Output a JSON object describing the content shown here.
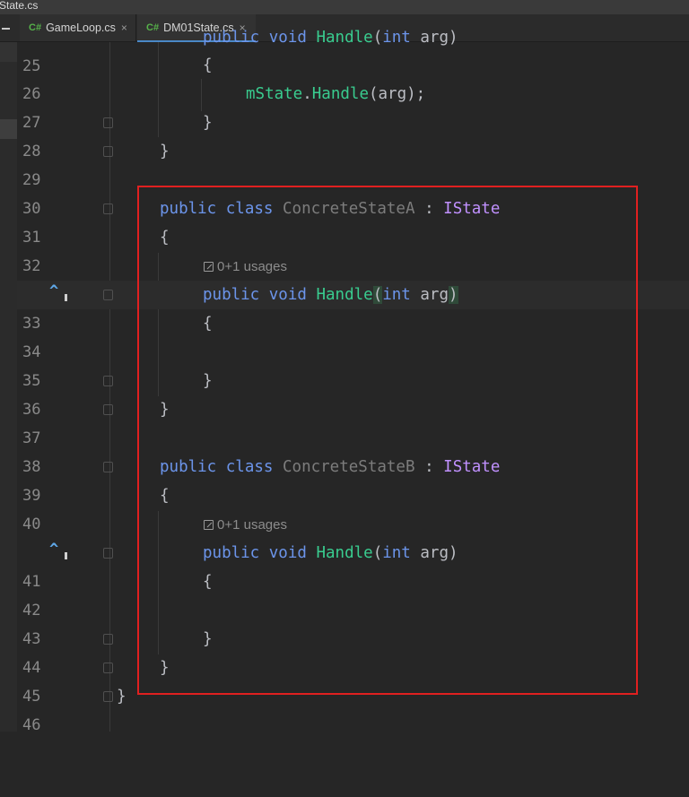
{
  "window": {
    "title_fragment": "State.cs"
  },
  "tabs": [
    {
      "icon": "C#",
      "label": "GameLoop.cs",
      "close": "×"
    },
    {
      "icon": "C#",
      "label": "DM01State.cs",
      "close": "×"
    }
  ],
  "lines": {
    "l25": {
      "num": "25",
      "kw1": "public",
      "kw2": "void",
      "meth": "Handle",
      "open": "(",
      "type": "int",
      "arg": "arg",
      "close": ")"
    },
    "l26": {
      "num": "26",
      "text": "{"
    },
    "l27": {
      "num": "27",
      "obj": "mState",
      "dot": ".",
      "meth": "Handle",
      "rest": "(arg);"
    },
    "l28": {
      "num": "28",
      "text": "}"
    },
    "l29": {
      "num": "29",
      "text": "}"
    },
    "l30": {
      "num": "30"
    },
    "l31": {
      "num": "31",
      "kw1": "public",
      "kw2": "class",
      "cls": "ConcreteStateA",
      "colon": ":",
      "iface": "IState"
    },
    "l32": {
      "num": "32",
      "text": "{"
    },
    "usageA": "0+1 usages",
    "l33": {
      "num": "33",
      "kw1": "public",
      "kw2": "void",
      "meth": "Handle",
      "open": "(",
      "type": "int",
      "arg": "arg",
      "close": ")"
    },
    "l34": {
      "num": "34",
      "text": "{"
    },
    "l35": {
      "num": "35"
    },
    "l36": {
      "num": "36",
      "text": "}"
    },
    "l37": {
      "num": "37",
      "text": "}"
    },
    "l38": {
      "num": "38"
    },
    "l39": {
      "num": "39",
      "kw1": "public",
      "kw2": "class",
      "cls": "ConcreteStateB",
      "colon": ":",
      "iface": "IState"
    },
    "l40": {
      "num": "40",
      "text": "{"
    },
    "usageB": "0+1 usages",
    "l41": {
      "num": "41",
      "kw1": "public",
      "kw2": "void",
      "meth": "Handle",
      "open": "(",
      "type": "int",
      "arg": "arg",
      "close": ")"
    },
    "l42": {
      "num": "42",
      "text": "{"
    },
    "l43": {
      "num": "43"
    },
    "l44": {
      "num": "44",
      "text": "}"
    },
    "l45": {
      "num": "45",
      "text": "}"
    },
    "l46": {
      "num": "46",
      "text": "}"
    }
  },
  "colors": {
    "keyword": "#6c95eb",
    "method": "#39cc8f",
    "interface": "#c191ff",
    "class_name": "#7c7c7c",
    "highlight_box": "#e02020",
    "background": "#262626"
  }
}
